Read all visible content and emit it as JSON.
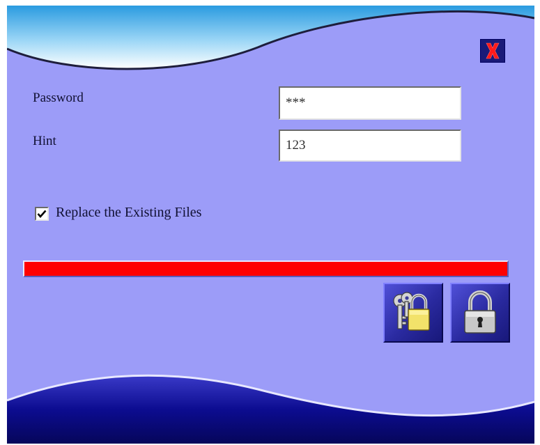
{
  "dialog": {
    "close_icon": "close-x-icon",
    "close_color": "#ff1a1a"
  },
  "fields": {
    "password_label": "Password",
    "password_value": "***",
    "hint_label": "Hint",
    "hint_value": "123"
  },
  "options": {
    "replace_label": "Replace the Existing Files",
    "replace_checked": true
  },
  "progress": {
    "fraction": 1.0,
    "color": "#ff0000"
  },
  "actions": {
    "encrypt_icon": "keys-padlock-icon",
    "lock_icon": "padlock-icon"
  },
  "colors": {
    "background": "#9c9cf8",
    "wave_light": "#2a9be0",
    "wave_dark": "#0a0a80"
  }
}
